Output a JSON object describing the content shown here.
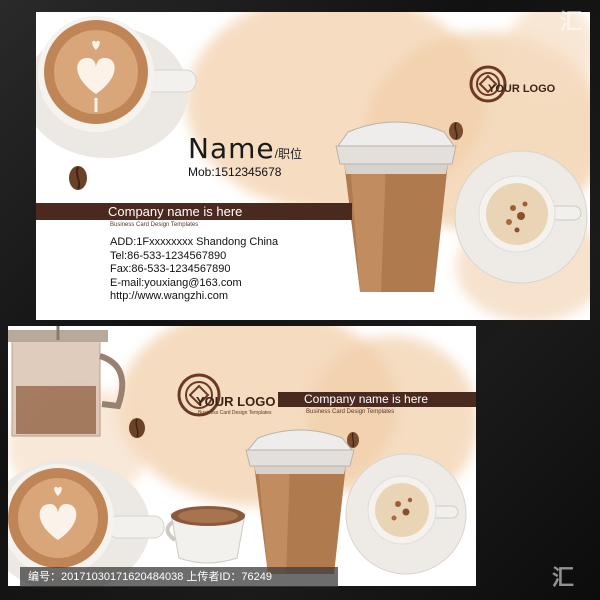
{
  "card_front": {
    "name": "Name",
    "position": "/职位",
    "mobile": "Mob:1512345678",
    "company": "Company name is here",
    "templates": "Business Card Design Templates",
    "address": "ADD:1Fxxxxxxxx Shandong China",
    "tel": "Tel:86-533-1234567890",
    "fax": "Fax:86-533-1234567890",
    "email": "E-mail:youxiang@163.com",
    "website": "http://www.wangzhi.com",
    "logo": "YOUR LOGO"
  },
  "card_back": {
    "logo": "YOUR LOGO",
    "logo_sub": "Business Card Design Templates",
    "company": "Company name is here",
    "templates": "Business Card Design Templates"
  },
  "footer": {
    "text": "编号：20171030171620484038 上传者ID：76249"
  },
  "colors": {
    "bar": "#4a2a1e",
    "wash": "#f1cfa9",
    "coffee": "#8b5a3c"
  }
}
